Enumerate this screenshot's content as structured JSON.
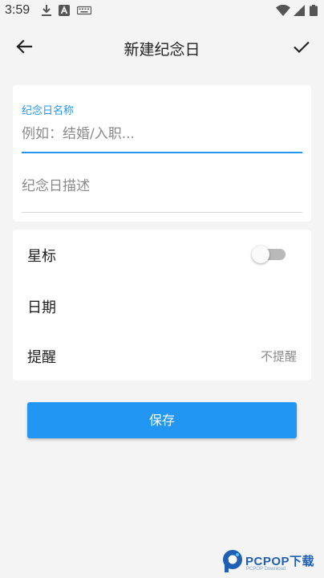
{
  "status_bar": {
    "time": "3:59",
    "icons": [
      "download-icon",
      "a-app-icon",
      "keyboard-icon",
      "wifi-icon",
      "signal-icon",
      "battery-icon"
    ]
  },
  "toolbar": {
    "back_icon": "arrow-left-icon",
    "title": "新建纪念日",
    "confirm_icon": "checkmark-icon"
  },
  "form": {
    "name_label": "纪念日名称",
    "name_value": "",
    "name_placeholder": "例如：结婚/入职...",
    "desc_value": "",
    "desc_placeholder": "纪念日描述"
  },
  "settings": {
    "star_label": "星标",
    "star_enabled": false,
    "date_label": "日期",
    "date_value": "",
    "remind_label": "提醒",
    "remind_value": "不提醒"
  },
  "save_label": "保存",
  "watermark": {
    "brand": "PCPOP下载",
    "sub": "PCPOP Download"
  },
  "colors": {
    "accent": "#2196f3",
    "background": "#f4f4f4",
    "card": "#ffffff",
    "toggle_off_track": "#b9b9b9",
    "hint_text": "#8a8a8a"
  }
}
